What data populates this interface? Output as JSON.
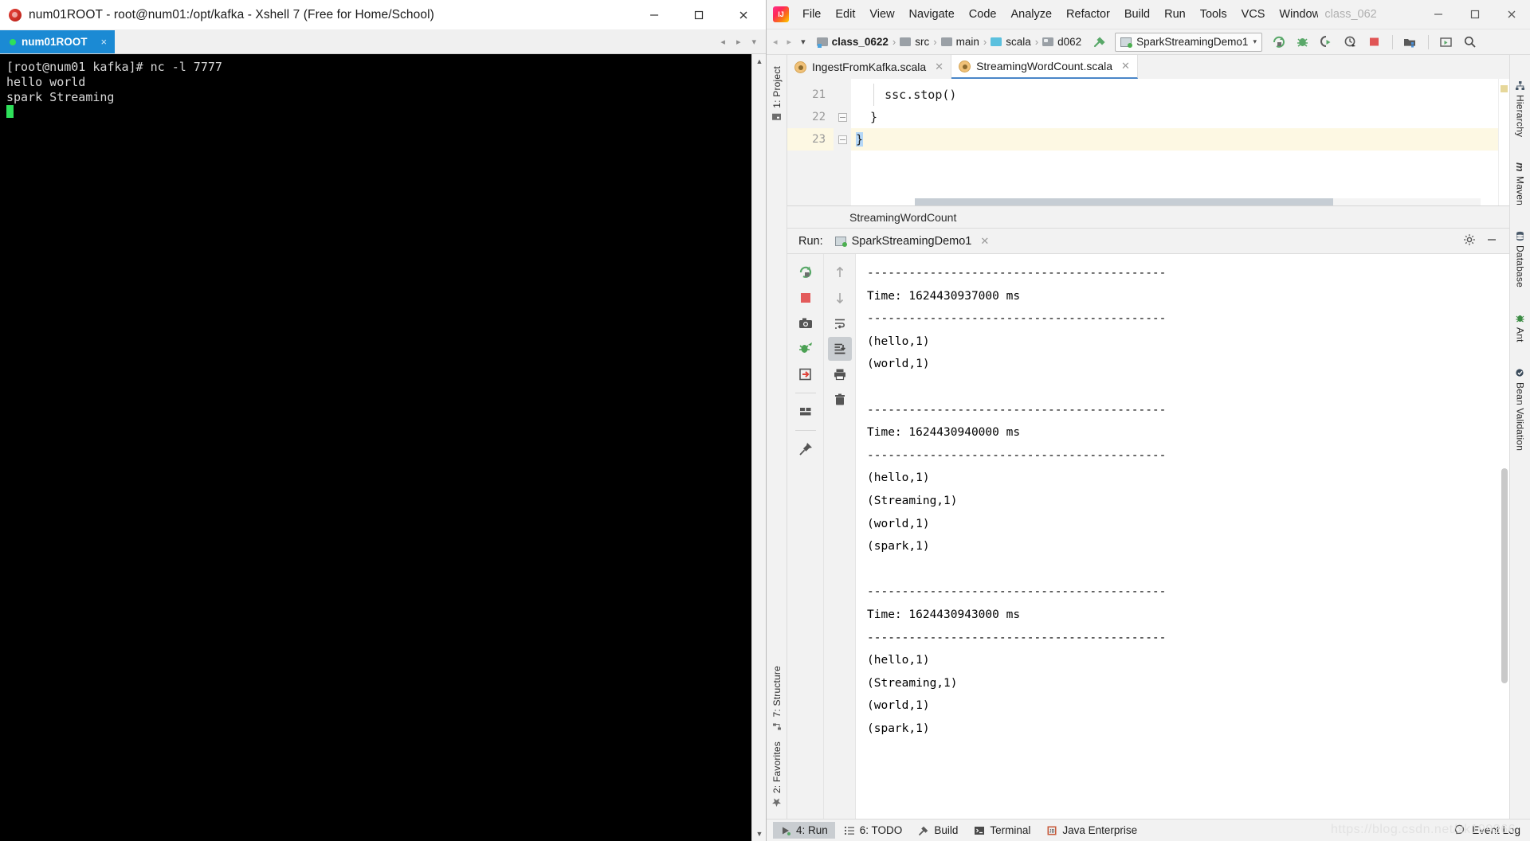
{
  "xshell": {
    "window_title": "num01ROOT - root@num01:/opt/kafka - Xshell 7 (Free for Home/School)",
    "logo_name": "xshell-logo",
    "tab": {
      "label": "num01ROOT",
      "close": "×"
    },
    "window_buttons": {
      "minimize": "─",
      "maximize": "□",
      "close": "✕"
    },
    "terminal_lines": [
      "[root@num01 kafka]# nc -l 7777",
      "hello world",
      "spark Streaming"
    ]
  },
  "idea": {
    "app_icon": "intellij-idea-icon",
    "menu": [
      {
        "label": "File",
        "mnemonic": "F"
      },
      {
        "label": "Edit",
        "mnemonic": "E"
      },
      {
        "label": "View",
        "mnemonic": "V"
      },
      {
        "label": "Navigate",
        "mnemonic": "N"
      },
      {
        "label": "Code",
        "mnemonic": "C"
      },
      {
        "label": "Analyze",
        "mnemonic": "y"
      },
      {
        "label": "Refactor",
        "mnemonic": "R"
      },
      {
        "label": "Build",
        "mnemonic": "B"
      },
      {
        "label": "Run",
        "mnemonic": "u"
      },
      {
        "label": "Tools",
        "mnemonic": "T"
      },
      {
        "label": "VCS",
        "mnemonic": "S"
      },
      {
        "label": "Window",
        "mnemonic": "W"
      }
    ],
    "project_ghost_label": "class_062",
    "window_buttons": {
      "minimize": "─",
      "maximize": "□",
      "close": "✕"
    },
    "navbar": {
      "back_forward": {
        "back": "◂",
        "forward": "▸",
        "dropdown": "▾"
      },
      "breadcrumbs": [
        {
          "label": "class_0622",
          "icon": "project-folder-icon",
          "bold": true
        },
        {
          "label": "src",
          "icon": "folder-icon",
          "bold": false
        },
        {
          "label": "main",
          "icon": "folder-icon",
          "bold": false
        },
        {
          "label": "scala",
          "icon": "source-folder-icon",
          "bold": false
        },
        {
          "label": "d062",
          "icon": "package-folder-icon",
          "bold": false
        }
      ],
      "separator": "›",
      "build_hammer_icon": "build-hammer-icon",
      "run_config": {
        "label": "SparkStreamingDemo1",
        "icon": "run-config-icon",
        "chevron": "▾"
      },
      "toolbar_icons": [
        "rerun-icon",
        "debug-icon",
        "coverage-icon",
        "profile-icon",
        "stop-icon",
        "project-structure-icon",
        "search-everywhere-icon"
      ]
    },
    "left_rail": [
      {
        "label": "1: Project",
        "icon": "project-tool-icon"
      },
      {
        "label": "7: Structure",
        "icon": "structure-tool-icon"
      },
      {
        "label": "2: Favorites",
        "icon": "favorites-star-icon"
      }
    ],
    "right_rail": [
      {
        "label": "Hierarchy",
        "icon": "hierarchy-icon"
      },
      {
        "label": "Maven",
        "icon": "maven-icon"
      },
      {
        "label": "Database",
        "icon": "database-icon"
      },
      {
        "label": "Ant",
        "icon": "ant-icon"
      },
      {
        "label": "Bean Validation",
        "icon": "bean-validation-icon"
      }
    ],
    "editor_tabs": [
      {
        "label": "IngestFromKafka.scala",
        "icon": "scala-file-icon",
        "active": false,
        "close": "✕"
      },
      {
        "label": "StreamingWordCount.scala",
        "icon": "scala-file-icon",
        "active": true,
        "close": "✕"
      }
    ],
    "editor": {
      "lines": [
        {
          "number": "21",
          "text": "    ssc.stop()",
          "current": false,
          "fold": false
        },
        {
          "number": "22",
          "text": "  }",
          "current": false,
          "fold": true
        },
        {
          "number": "23",
          "text": "}",
          "current": true,
          "fold": true
        }
      ]
    },
    "breadcrumb_bottom": "StreamingWordCount",
    "run_panel": {
      "title": "Run:",
      "tab_label": "SparkStreamingDemo1",
      "tab_icon": "run-config-icon",
      "tab_close": "✕",
      "settings_icon": "gear-icon",
      "minimize_icon": "minimize-icon",
      "left_tool_icons": [
        "rerun-icon",
        "stop-icon",
        "screenshot-icon",
        "thread-dump-icon",
        "export-icon",
        "layout-icon",
        "pin-icon"
      ],
      "right_tool_icons": [
        "scroll-up-icon",
        "scroll-down-icon",
        "soft-wrap-icon",
        "scroll-to-end-icon",
        "print-icon",
        "clear-all-icon"
      ],
      "console_lines": [
        "-------------------------------------------",
        "Time: 1624430937000 ms",
        "-------------------------------------------",
        "(hello,1)",
        "(world,1)",
        "",
        "-------------------------------------------",
        "Time: 1624430940000 ms",
        "-------------------------------------------",
        "(hello,1)",
        "(Streaming,1)",
        "(world,1)",
        "(spark,1)",
        "",
        "-------------------------------------------",
        "Time: 1624430943000 ms",
        "-------------------------------------------",
        "(hello,1)",
        "(Streaming,1)",
        "(world,1)",
        "(spark,1)"
      ]
    },
    "statusbar": {
      "buttons": [
        {
          "label": "4: Run",
          "mnemonic": "4",
          "icon": "run-icon",
          "active": true
        },
        {
          "label": "6: TODO",
          "mnemonic": "6",
          "icon": "todo-list-icon",
          "active": false
        },
        {
          "label": "Build",
          "mnemonic": "",
          "icon": "build-hammer-icon",
          "active": false
        },
        {
          "label": "Terminal",
          "mnemonic": "",
          "icon": "terminal-icon",
          "active": false
        },
        {
          "label": "Java Enterprise",
          "mnemonic": "",
          "icon": "java-enterprise-icon",
          "active": false
        }
      ],
      "event_log": {
        "label": "Event Log",
        "icon": "event-log-icon"
      },
      "watermark": "https://blog.csdn.net/xk199266"
    }
  },
  "colors": {
    "accent_blue": "#1b8ad4",
    "idea_bg": "#f2f2f2",
    "terminal_bg": "#000000",
    "terminal_fg": "#d8d8d8",
    "cursor_green": "#2ee05a",
    "current_line": "#fdf8e3"
  }
}
